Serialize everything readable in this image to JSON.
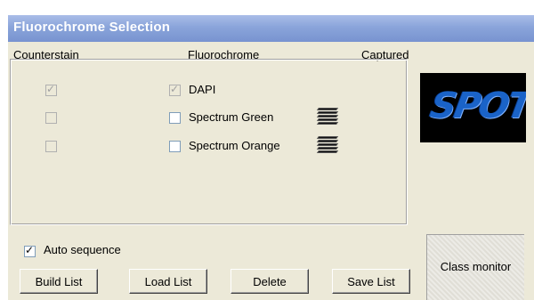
{
  "window": {
    "title": "Fluorochrome Selection"
  },
  "headers": {
    "counterstain": "Counterstain",
    "fluorochrome": "Fluorochrome",
    "captured": "Captured"
  },
  "rows": [
    {
      "label": "DAPI",
      "counterstain_checked": true,
      "counterstain_disabled": true,
      "fluor_checked": true,
      "fluor_disabled": true,
      "captured_icon": "none"
    },
    {
      "label": "Spectrum Green",
      "counterstain_checked": false,
      "counterstain_disabled": true,
      "fluor_checked": false,
      "fluor_disabled": false,
      "captured_icon": "image-stack-icon"
    },
    {
      "label": "Spectrum Orange",
      "counterstain_checked": false,
      "counterstain_disabled": true,
      "fluor_checked": false,
      "fluor_disabled": false,
      "captured_icon": "image-stack-icon"
    }
  ],
  "logo": {
    "text": "SPOT"
  },
  "auto_sequence": {
    "label": "Auto sequence",
    "checked": true
  },
  "buttons": {
    "build_list": "Build List",
    "load_list": "Load List",
    "delete": "Delete",
    "save_list": "Save List"
  },
  "class_monitor": {
    "label": "Class monitor"
  },
  "colors": {
    "titlebar": "#8aa4da",
    "window_bg": "#ece9d8",
    "logo_blue": "#1a63c8"
  }
}
